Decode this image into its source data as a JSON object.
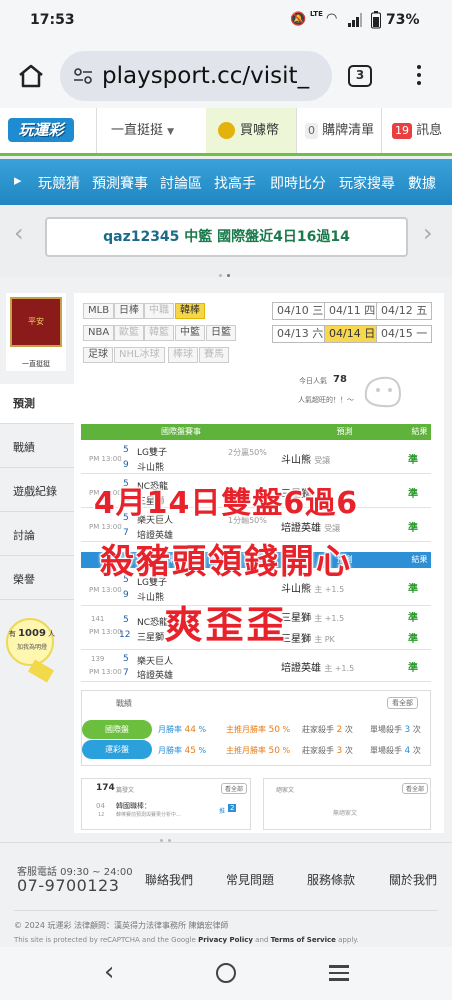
{
  "status": {
    "time": "17:53",
    "battery": "73%",
    "lte": "LTE"
  },
  "browser": {
    "url": "playsport.cc/visit_",
    "tabs": "3"
  },
  "site": {
    "logo": "玩運彩",
    "dropdown": "一直挺挺",
    "buy": "買噱幣",
    "cart_count": "0",
    "cart": "購牌清單",
    "msg_count": "19",
    "msg": "訊息"
  },
  "nav": [
    "玩競猜",
    "預測賽事",
    "討論區",
    "找高手",
    "即時比分",
    "玩家搜尋",
    "數據"
  ],
  "ticker": {
    "user": "qaz12345",
    "text": " 中籃 國際盤近4日16過14"
  },
  "profile": {
    "name": "一直挺挺",
    "avatar_text": "平安"
  },
  "sidebar": [
    "預測",
    "戰績",
    "遊戲紀錄",
    "討論",
    "榮譽"
  ],
  "fans": {
    "prefix": "有",
    "count": "1009",
    "suffix": "人",
    "line2": "加我為明燈"
  },
  "leagues": {
    "row1": [
      "MLB",
      "日棒",
      "中職",
      "韓棒"
    ],
    "row2": [
      "NBA",
      "歐籃",
      "韓籃",
      "中籃",
      "日籃"
    ],
    "row3": [
      "足球",
      "NHL冰球",
      "棒球",
      "賽馬"
    ]
  },
  "dates": [
    "04/10 三",
    "04/11 四",
    "04/12 五",
    "04/13 六",
    "04/14 日",
    "04/15 一"
  ],
  "today": {
    "label": "今日人氣",
    "value": "78",
    "sub": "人氣超旺的！！～"
  },
  "table1": {
    "headers": [
      "國際盤賽事",
      "預測",
      "結果"
    ],
    "rows": [
      {
        "time": "PM 13:00",
        "n1": "5",
        "t1": "LG雙子",
        "n2": "9",
        "t2": "斗山熊",
        "spread": "2分贏50%",
        "pick": "斗山熊",
        "pick_note": "受讓",
        "res": "準"
      },
      {
        "time": "PM 13:00",
        "n1": "5",
        "t1": "NC恐龍",
        "n2": "12",
        "t2": "三星獅",
        "spread": "",
        "pick": "三星獅",
        "pick_note": "",
        "res": "準"
      },
      {
        "time": "PM 13:00",
        "n1": "5",
        "t1": "樂天巨人",
        "n2": "7",
        "t2": "培證英雄",
        "spread": "1分輸50%",
        "pick": "培證英雄",
        "pick_note": "受讓",
        "res": "準"
      }
    ]
  },
  "table2": {
    "headers": [
      "運彩盤賽事",
      "預測",
      "結果"
    ],
    "rows": [
      {
        "time": "PM 13:00",
        "id": "",
        "n1": "5",
        "t1": "LG雙子",
        "n2": "9",
        "t2": "斗山熊",
        "pick": "斗山熊",
        "pick_note": "主 +1.5",
        "res": "準"
      },
      {
        "time": "PM 13:00",
        "id": "141",
        "n1": "5",
        "t1": "NC恐龍",
        "n2": "12",
        "t2": "三星獅",
        "pick": "三星獅",
        "pick_note": "主 +1.5",
        "pick2": "三星獅",
        "pick2_note": "主 PK",
        "res": "準",
        "res2": "準"
      },
      {
        "time": "PM 13:00",
        "id": "139",
        "n1": "5",
        "t1": "樂天巨人",
        "n2": "7",
        "t2": "培證英雄",
        "pick": "培證英雄",
        "pick_note": "主 +1.5",
        "res": "準"
      }
    ]
  },
  "overlay": {
    "line1": "4月14日雙盤6過6",
    "line2": "殺豬頭領錢開心",
    "line3": "爽歪歪"
  },
  "stats": {
    "title": "戰績",
    "more": "看全部",
    "rows": [
      {
        "label": "國際盤",
        "win_label": "月勝率",
        "win": "44",
        "main_label": "主推月勝率",
        "main": "50",
        "streak_label": "莊家殺手",
        "streak": "2",
        "single_label": "單場殺手",
        "single": "3"
      },
      {
        "label": "運彩盤",
        "win_label": "月勝率",
        "win": "45",
        "main_label": "主推月勝率",
        "main": "50",
        "streak_label": "莊家殺手",
        "streak": "3",
        "single_label": "單場殺手",
        "single": "4"
      }
    ]
  },
  "posts": {
    "count": "174",
    "label": "篇發文",
    "more": "看全部",
    "item_date": "04",
    "item_date2": "12",
    "item_title": "韓國職棒：",
    "item_desc": "韓棒賽前預測與賽果分析中...",
    "item_badge": "2",
    "item_tag": "推"
  },
  "fav": {
    "title": "絕家文",
    "more": "看全部",
    "empty": "無絕家文"
  },
  "footer": {
    "phone_label": "客服電話 09:30 ~ 24:00",
    "phone": "07-9700123",
    "links": [
      "聯絡我們",
      "常見問題",
      "服務條款",
      "關於我們"
    ],
    "copyright": "© 2024 玩運彩 法律顧問：漢英得力法律事務所 陳鎮宏律師",
    "recaptcha_prefix": "This site is protected by reCAPTCHA and the Google ",
    "privacy": "Privacy Policy",
    "and": " and ",
    "terms": "Terms of Service",
    "apply": " apply."
  },
  "colors": {
    "green": "#5fb23a",
    "blue": "#2d8fd5",
    "red": "#e8222a",
    "yellow": "#f5d64a"
  }
}
